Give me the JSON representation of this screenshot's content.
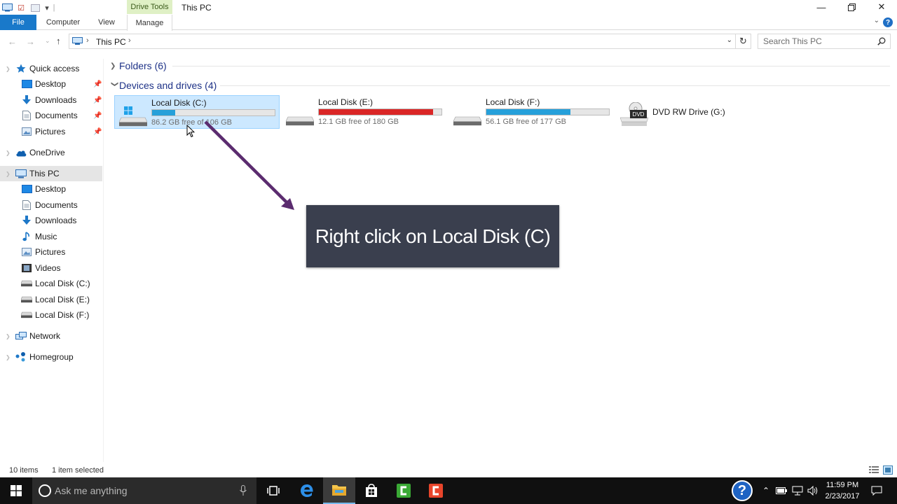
{
  "window": {
    "title": "This PC",
    "contextual_tab": "Drive Tools"
  },
  "ribbon": {
    "tabs": [
      "File",
      "Computer",
      "View",
      "Manage"
    ]
  },
  "address": {
    "path": "This PC",
    "search_placeholder": "Search This PC"
  },
  "sidebar": {
    "items": [
      {
        "label": "Quick access",
        "icon": "star-icon",
        "level": 0,
        "pinned": false
      },
      {
        "label": "Desktop",
        "icon": "desktop-icon",
        "level": 1,
        "pinned": true
      },
      {
        "label": "Downloads",
        "icon": "downloads-icon",
        "level": 1,
        "pinned": true
      },
      {
        "label": "Documents",
        "icon": "documents-icon",
        "level": 1,
        "pinned": true
      },
      {
        "label": "Pictures",
        "icon": "pictures-icon",
        "level": 1,
        "pinned": true
      },
      {
        "label": "OneDrive",
        "icon": "onedrive-icon",
        "level": 0,
        "pinned": false
      },
      {
        "label": "This PC",
        "icon": "this-pc-icon",
        "level": 0,
        "pinned": false,
        "selected": true
      },
      {
        "label": "Desktop",
        "icon": "desktop-icon",
        "level": 1,
        "pinned": false
      },
      {
        "label": "Documents",
        "icon": "documents-icon",
        "level": 1,
        "pinned": false
      },
      {
        "label": "Downloads",
        "icon": "downloads-icon",
        "level": 1,
        "pinned": false
      },
      {
        "label": "Music",
        "icon": "music-icon",
        "level": 1,
        "pinned": false
      },
      {
        "label": "Pictures",
        "icon": "pictures-icon",
        "level": 1,
        "pinned": false
      },
      {
        "label": "Videos",
        "icon": "videos-icon",
        "level": 1,
        "pinned": false
      },
      {
        "label": "Local Disk (C:)",
        "icon": "drive-icon",
        "level": 1,
        "pinned": false
      },
      {
        "label": "Local Disk (E:)",
        "icon": "drive-icon",
        "level": 1,
        "pinned": false
      },
      {
        "label": "Local Disk (F:)",
        "icon": "drive-icon",
        "level": 1,
        "pinned": false
      },
      {
        "label": "Network",
        "icon": "network-icon",
        "level": 0,
        "pinned": false
      },
      {
        "label": "Homegroup",
        "icon": "homegroup-icon",
        "level": 0,
        "pinned": false
      }
    ]
  },
  "content": {
    "folders_header": "Folders (6)",
    "devices_header": "Devices and drives (4)",
    "drives": [
      {
        "name": "Local Disk (C:)",
        "free": "86.2 GB free of 106 GB",
        "used_fraction": 0.187,
        "bar_color": "#26a0da",
        "selected": true,
        "windows": true
      },
      {
        "name": "Local Disk (E:)",
        "free": "12.1 GB free of 180 GB",
        "used_fraction": 0.933,
        "bar_color": "#da2626",
        "selected": false
      },
      {
        "name": "Local Disk (F:)",
        "free": "56.1 GB free of 177 GB",
        "used_fraction": 0.683,
        "bar_color": "#26a0da",
        "selected": false
      }
    ],
    "dvd": {
      "name": "DVD RW Drive (G:)",
      "badge": "DVD"
    }
  },
  "callout": {
    "text": "Right click on Local Disk (C)"
  },
  "status": {
    "item_count": "10 items",
    "selection": "1 item selected"
  },
  "taskbar": {
    "search_placeholder": "Ask me anything",
    "time": "11:59 PM",
    "date": "2/23/2017"
  }
}
